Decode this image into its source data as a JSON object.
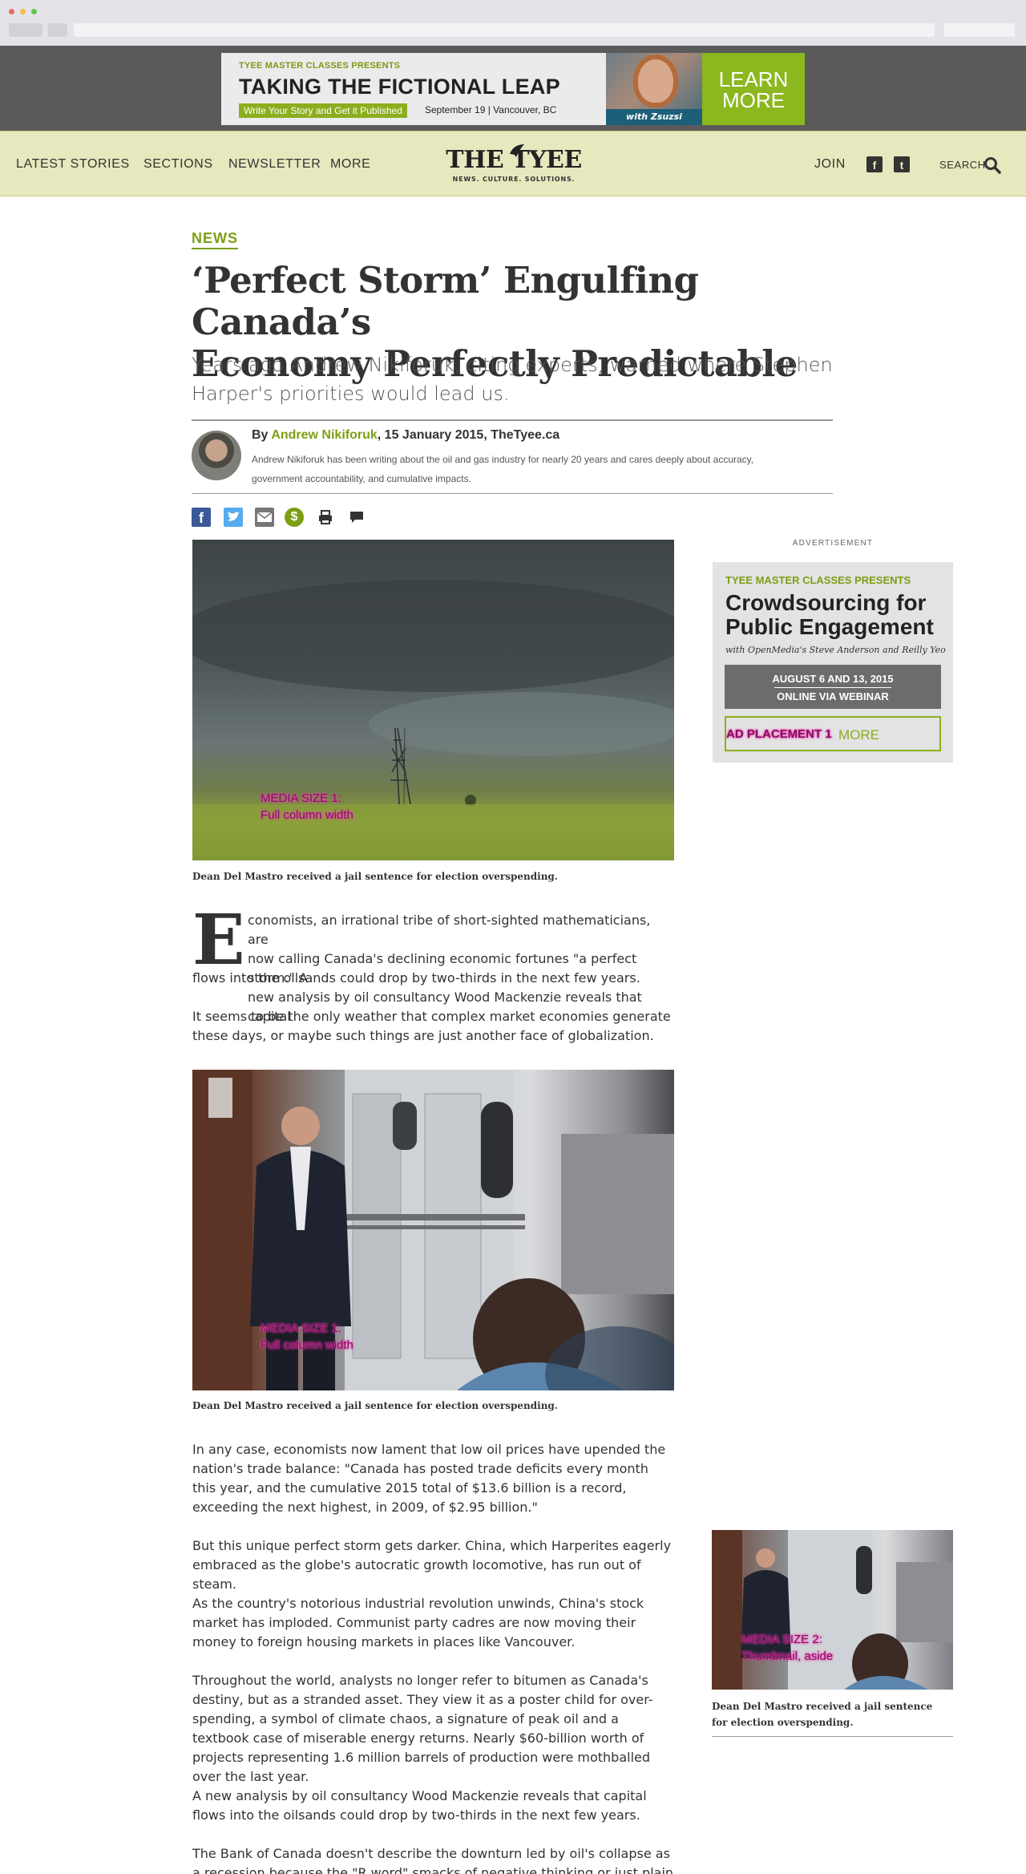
{
  "banner": {
    "kicker": "TYEE MASTER CLASSES PRESENTS",
    "title": "TAKING THE FICTIONAL LEAP",
    "tag": "Write Your Story and Get it Published",
    "date": "September 19 | Vancouver, BC",
    "presenter": "with Zsuzsi Gartner",
    "cta_line1": "LEARN",
    "cta_line2": "MORE"
  },
  "nav": {
    "items": [
      "LATEST STORIES",
      "SECTIONS",
      "NEWSLETTER",
      "MORE"
    ],
    "logo": "THE TYEE",
    "logo_tagline": "NEWS. CULTURE. SOLUTIONS.",
    "join": "JOIN",
    "search": "SEARCH"
  },
  "article": {
    "section": "NEWS",
    "headline_line1": "‘Perfect Storm’ Engulfing Canada’s",
    "headline_line2": "Economy Perfectly Predictable",
    "deck_line1": "Years ago Andrew Nikiforuk, citing experts, warned where Stephen",
    "deck_line2": "Harper's priorities would lead us.",
    "byline_prefix": "By ",
    "author": "Andrew Nikiforuk",
    "byline_suffix": ", 15 January 2015, TheTyee.ca",
    "bio_line1": "Andrew Nikiforuk has been writing about the oil and gas industry for nearly 20 years and cares deeply about accuracy,",
    "bio_line2": "government accountability, and cumulative impacts.",
    "media1_label_line1": "MEDIA SIZE 1:",
    "media1_label_line2": "Full column width",
    "caption1": "Dean Del Mastro received a jail sentence for election overspending.",
    "dropcap": "E",
    "p1_line1": "conomists, an irrational tribe of short-sighted mathematicians, are",
    "p1_line2": "now calling Canada's declining economic fortunes \"a perfect storm.\" A",
    "p1_line3": "new analysis by oil consultancy Wood Mackenzie reveals that capital",
    "p1_line4": "flows into the oilsands could drop by two-thirds in the next few years.",
    "p2": "It seems to be the only weather that complex market economies generate these days, or maybe such things are just another face of globalization.",
    "media2_label_line1": "MEDIA SIZE 1:",
    "media2_label_line2": "Full column width",
    "caption2": "Dean Del Mastro received a jail sentence for election overspending.",
    "p3": "In any case, economists now lament that low oil prices have upended the nation's trade balance: \"Canada has posted trade deficits every month this year, and the cumulative 2015 total of $13.6 billion is a record, exceeding the next highest, in 2009, of $2.95 billion.\"",
    "p4": "But this unique perfect storm gets darker. China, which Harperites eagerly embraced as the globe's autocratic growth locomotive, has run out of steam.",
    "p5": "As the country's notorious industrial revolution unwinds, China's stock market has imploded. Communist party cadres are now moving their money to foreign housing markets in places like Vancouver.",
    "p6": "Throughout the world, analysts no longer refer to bitumen as Canada's destiny, but as a stranded asset. They view it as a poster child for over-spending, a symbol of climate chaos, a signature of peak oil and a textbook case of miserable energy returns. Nearly $60-billion worth of projects representing 1.6 million barrels of production were mothballed over the last year.",
    "p7": "A new analysis by oil consultancy Wood Mackenzie reveals that capital flows into the oilsands could drop by two-thirds in the next few years.",
    "p8": "The Bank of Canada doesn't describe the downturn led by oil's collapse as a recession because the \"R word\" smacks of negative thinking or just plain reality."
  },
  "sidebar": {
    "ad_label": "ADVERTISEMENT",
    "ad_kicker": "TYEE MASTER CLASSES PRESENTS",
    "ad_title_line1": "Crowdsourcing for",
    "ad_title_line2": "Public Engagement",
    "ad_sub": "with OpenMedia's Steve Anderson and Reilly Yeo",
    "ad_dates": "AUGUST 6 AND 13, 2015",
    "ad_format": "ONLINE VIA WEBINAR",
    "ad_placement_label": "AD PLACEMENT 1",
    "ad_more": "MORE",
    "thumb_label_line1": "MEDIA SIZE 2:",
    "thumb_label_line2": "Thumbnail, aside",
    "thumb_caption": "Dean Del Mastro received a jail sentence for election overspending."
  },
  "colors": {
    "accent": "#7c9f14",
    "nav_bg": "#e6e8bd",
    "cta": "#8cb71f"
  }
}
